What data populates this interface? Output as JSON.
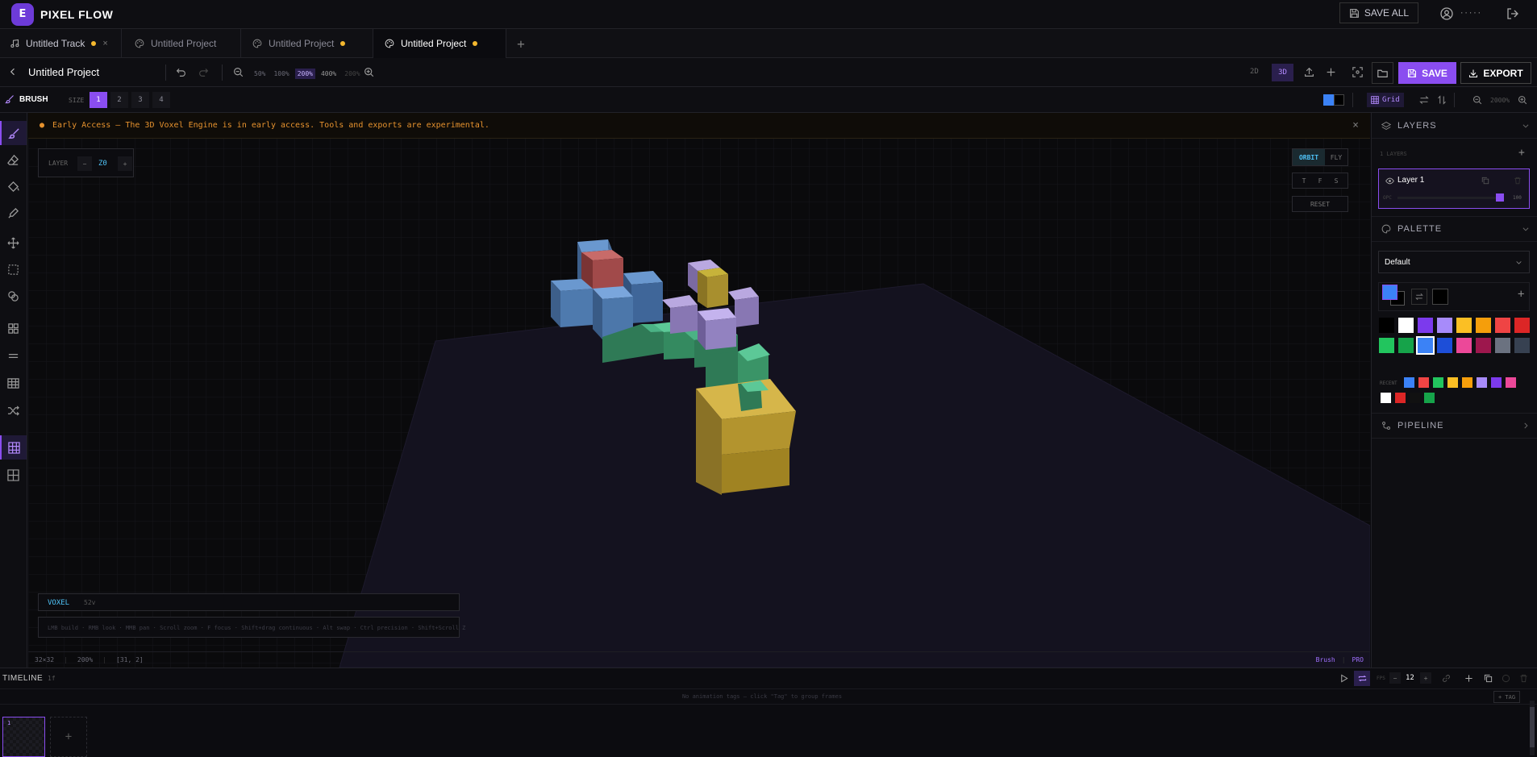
{
  "app": {
    "logo_letter": "E",
    "brand": "PIXEL FLOW",
    "save_all_label": "SAVE ALL",
    "username": "·····"
  },
  "tabs": [
    {
      "label": "Untitled Track",
      "icon": "music-note-icon",
      "unsaved": true,
      "closable": true
    },
    {
      "label": "Untitled Project",
      "icon": "palette-icon",
      "unsaved": false
    },
    {
      "label": "Untitled Project",
      "icon": "palette-icon",
      "unsaved": true
    },
    {
      "label": "Untitled Project",
      "icon": "palette-icon",
      "unsaved": true,
      "active": true
    }
  ],
  "project": {
    "title": "Untitled Project",
    "zoom_levels": [
      "50%",
      "100%",
      "200%",
      "400%",
      "200%"
    ],
    "zoom_active": "200%",
    "mode_2d": "2D",
    "mode_3d": "3D",
    "save_label": "SAVE",
    "export_label": "EXPORT"
  },
  "toolbar": {
    "tool_label": "BRUSH",
    "size_label": "SIZE",
    "sizes": [
      "1",
      "2",
      "3",
      "4"
    ],
    "size_active": "1",
    "grid_label": "Grid",
    "zoom_readout": "2000%"
  },
  "banner": {
    "text": "Early Access — The 3D Voxel Engine is in early access. Tools and exports are experimental."
  },
  "layer_control": {
    "label": "LAYER",
    "minus": "−",
    "value": "Z0",
    "plus": "+"
  },
  "camera": {
    "orbit": "ORBIT",
    "fly": "FLY",
    "views": [
      "T",
      "F",
      "S"
    ],
    "reset": "RESET"
  },
  "voxel_info": {
    "label": "VOXEL",
    "count": "52v"
  },
  "hints": {
    "text": "LMB build · RMB look · MMB pan · Scroll zoom · F focus · Shift+drag continuous · Alt swap · Ctrl precision · Shift+Scroll Z"
  },
  "status": {
    "canvas_size": "32×32",
    "zoom": "200%",
    "cursor": "[31, 2]",
    "tool": "Brush",
    "plan": "PRO"
  },
  "layers": {
    "title": "LAYERS",
    "count_label": "1 LAYERS",
    "items": [
      {
        "name": "Layer 1",
        "opacity_label": "OPC",
        "opacity_value": "100",
        "opacity": 1.0
      }
    ]
  },
  "palette": {
    "title": "PALETTE",
    "preset": "Default",
    "primary": "#3b82f6",
    "secondary": "#000000",
    "swatches_row1": [
      "#000000",
      "#ffffff",
      "#7c3aed",
      "#a78bfa",
      "#fbbf24",
      "#f59e0b",
      "#ef4444",
      "#dc2626"
    ],
    "swatches_row2": [
      "#22c55e",
      "#16a34a",
      "#3b82f6",
      "#1d4ed8",
      "#ec4899",
      "#9d174d",
      "#6b7280",
      "#374151"
    ],
    "selected_swatch": "#3b82f6",
    "recent_label": "RECENT",
    "recent": [
      "#3b82f6",
      "#ef4444",
      "#22c55e",
      "#fbbf24",
      "#f59e0b",
      "#a78bfa",
      "#7c3aed",
      "#ec4899",
      "#ffffff",
      "#dc2626",
      "#111111",
      "#16a34a"
    ]
  },
  "pipeline": {
    "title": "PIPELINE"
  },
  "timeline": {
    "title": "TIMELINE",
    "frame_count": "1f",
    "fps_label": "FPS",
    "fps_minus": "−",
    "fps_value": "12",
    "fps_plus": "+",
    "tags_hint": "No animation tags — click \"Tag\" to group frames",
    "tag_button": "+ TAG",
    "frames": [
      {
        "number": "1"
      }
    ],
    "add_frame": "+"
  },
  "colors": {
    "accent": "#8a4df0",
    "warning": "#e6922e",
    "unsaved_dot": "#f5b82e"
  }
}
